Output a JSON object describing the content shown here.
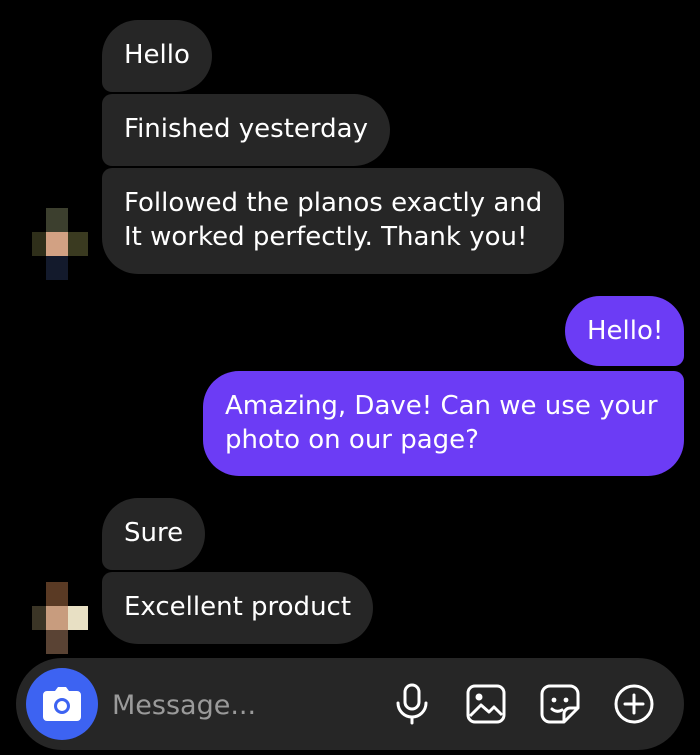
{
  "messages": [
    {
      "sender": "them",
      "text": "Hello"
    },
    {
      "sender": "them",
      "text": "Finished yesterday"
    },
    {
      "sender": "them",
      "lines": [
        "Followed the planos exactly and",
        "It worked perfectly. Thank you!"
      ]
    },
    {
      "sender": "me",
      "text": "Hello!"
    },
    {
      "sender": "me",
      "lines": [
        "Amazing, Dave! Can we use your",
        "photo on our page?"
      ]
    },
    {
      "sender": "them",
      "text": "Sure"
    },
    {
      "sender": "them",
      "text": "Excellent product"
    }
  ],
  "composer": {
    "placeholder": "Message...",
    "icons": [
      "camera-icon",
      "microphone-icon",
      "image-icon",
      "sticker-icon",
      "add-icon"
    ]
  },
  "colors": {
    "background": "#000000",
    "incoming_bubble": "#262626",
    "outgoing_bubble": "#6c3cf5",
    "camera_button": "#3d63f2"
  }
}
